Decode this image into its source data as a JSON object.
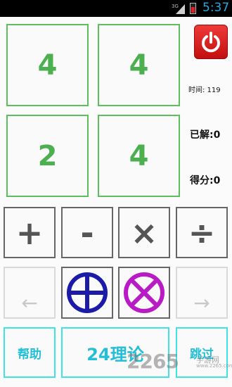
{
  "status_bar": {
    "network_label": "3G",
    "time": "5:37",
    "icons": [
      "signal-icon",
      "battery-icon"
    ]
  },
  "cards": [
    "4",
    "4",
    "2",
    "4"
  ],
  "timer": "时间: 119",
  "solved": "已解:0",
  "score": "得分:0",
  "operators": [
    "+",
    "-",
    "×",
    "÷"
  ],
  "row3": {
    "left_arrow": "←",
    "right_arrow": "→",
    "icons": [
      "circle-plus-icon",
      "circle-times-icon"
    ]
  },
  "bottom": {
    "help": "帮助",
    "theory": "24理论",
    "skip": "跳过"
  },
  "watermark": {
    "main": "2265",
    "site": "手游网",
    "url": "www.2265.com"
  },
  "colors": {
    "card_border": "#5cbf5c",
    "card_number": "#4caf50",
    "cyan": "#22bfd6",
    "plus_circle": "#1b1ba8",
    "times_circle": "#b81bc4",
    "power": "#e32222"
  }
}
